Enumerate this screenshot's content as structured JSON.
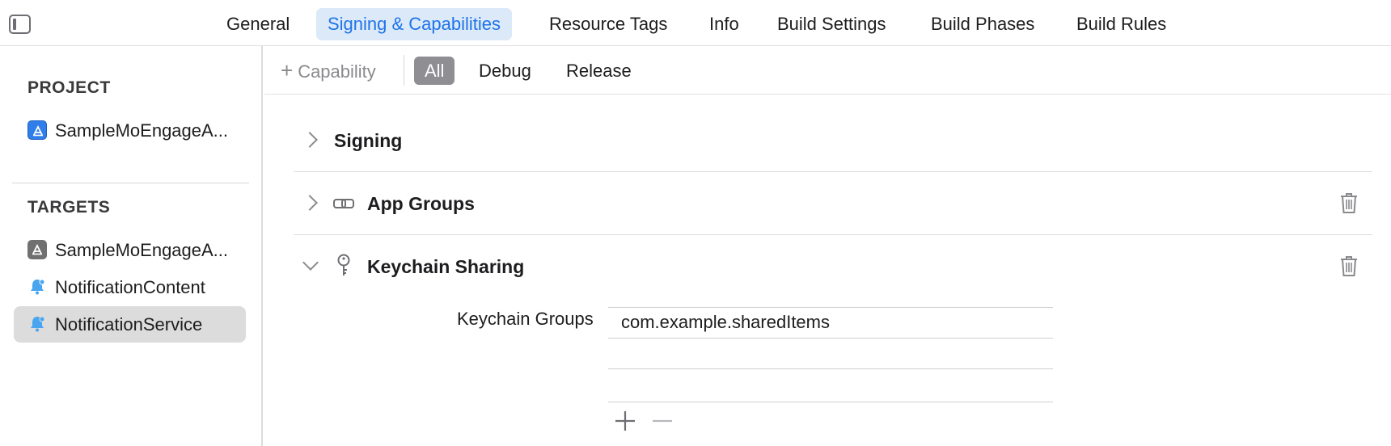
{
  "top_tabs": [
    {
      "label": "General",
      "active": false
    },
    {
      "label": "Signing & Capabilities",
      "active": true
    },
    {
      "label": "Resource Tags",
      "active": false
    },
    {
      "label": "Info",
      "active": false
    },
    {
      "label": "Build Settings",
      "active": false
    },
    {
      "label": "Build Phases",
      "active": false
    },
    {
      "label": "Build Rules",
      "active": false
    }
  ],
  "sidebar": {
    "project_header": "PROJECT",
    "project_item": {
      "label": "SampleMoEngageA...",
      "icon": "app-store-icon"
    },
    "targets_header": "TARGETS",
    "targets": [
      {
        "label": "SampleMoEngageA...",
        "icon": "app-store-icon",
        "selected": false
      },
      {
        "label": "NotificationContent",
        "icon": "bell-icon",
        "selected": false
      },
      {
        "label": "NotificationService",
        "icon": "bell-icon",
        "selected": true
      }
    ]
  },
  "toolbar": {
    "capability_label": "Capability",
    "filters": [
      {
        "label": "All",
        "active": true
      },
      {
        "label": "Debug",
        "active": false
      },
      {
        "label": "Release",
        "active": false
      }
    ]
  },
  "capabilities": [
    {
      "title": "Signing",
      "expanded": false,
      "icon": "",
      "deletable": false
    },
    {
      "title": "App Groups",
      "expanded": false,
      "icon": "link-icon",
      "deletable": true
    },
    {
      "title": "Keychain Sharing",
      "expanded": true,
      "icon": "key-icon",
      "deletable": true
    }
  ],
  "keychain": {
    "label": "Keychain Groups",
    "groups": [
      "com.example.sharedItems"
    ]
  },
  "colors": {
    "accent": "#1f74e8",
    "active_tab_bg": "#dbe9f9",
    "selected_row_bg": "#dcdcdc",
    "bell": "#4aa5f0"
  }
}
